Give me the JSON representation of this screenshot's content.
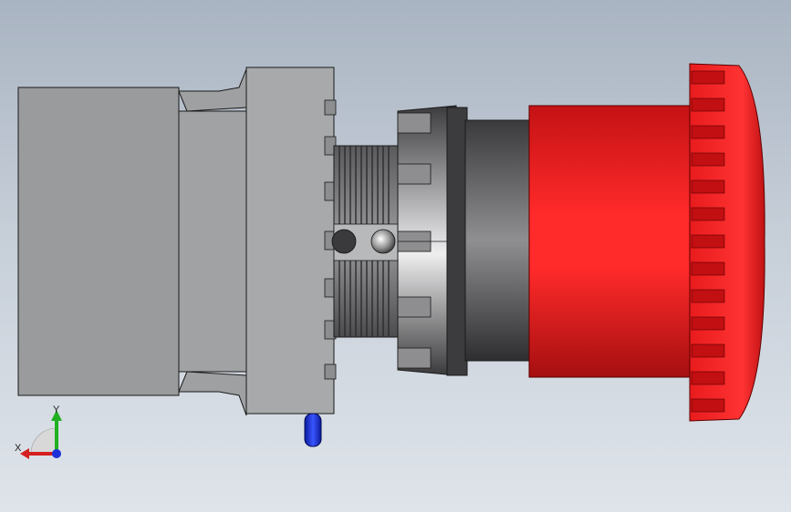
{
  "viewport": {
    "background_top": "#a9b4c2",
    "background_bottom": "#dfe4ea"
  },
  "model": {
    "contact_block_color": "#9a9b9d",
    "adapter_color": "#a7a9ab",
    "thread_color": "#6a6a6c",
    "collar_color": "#4b4b4d",
    "red_color": "#e0191b",
    "lamp_color": "#1b2fd0"
  },
  "triad": {
    "x_label": "X",
    "y_label": "Y",
    "x_axis_color": "#d42020",
    "y_axis_color": "#21b021",
    "z_axis_color": "#1d2fd8"
  }
}
